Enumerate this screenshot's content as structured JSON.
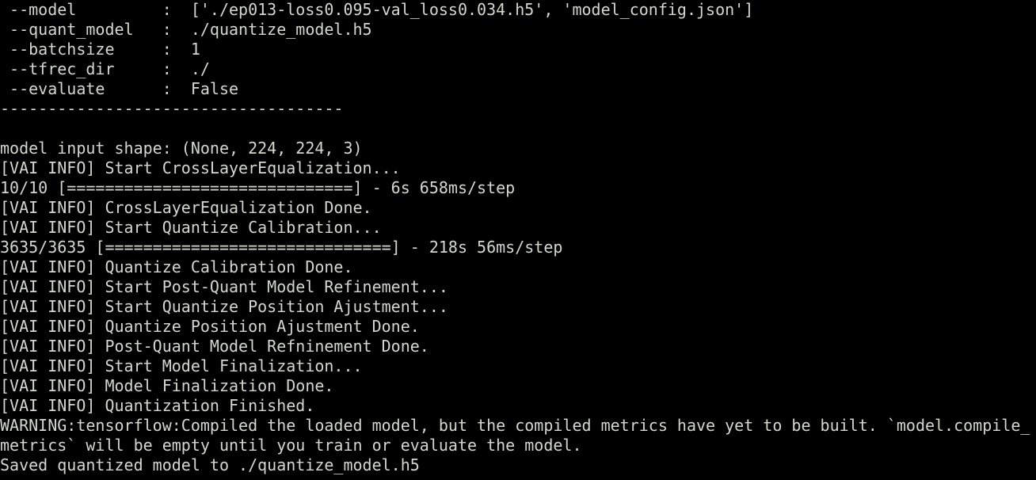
{
  "terminal": {
    "colors": {
      "background": "#000000",
      "foreground": "#d3d7cf",
      "highlight": "#cc0000"
    },
    "lines": [
      " --model         :  ['./ep013-loss0.095-val_loss0.034.h5', 'model_config.json']",
      " --quant_model   :  ./quantize_model.h5",
      " --batchsize     :  1",
      " --tfrec_dir     :  ./",
      " --evaluate      :  False",
      "------------------------------------",
      "",
      "model input shape: (None, 224, 224, 3)",
      "[VAI INFO] Start CrossLayerEqualization...",
      "10/10 [==============================] - 6s 658ms/step",
      "[VAI INFO] CrossLayerEqualization Done.",
      "[VAI INFO] Start Quantize Calibration...",
      "3635/3635 [==============================] - 218s 56ms/step",
      "[VAI INFO] Quantize Calibration Done.",
      "[VAI INFO] Start Post-Quant Model Refinement...",
      "[VAI INFO] Start Quantize Position Ajustment...",
      "[VAI INFO] Quantize Position Ajustment Done.",
      "[VAI INFO] Post-Quant Model Refninement Done.",
      "[VAI INFO] Start Model Finalization...",
      "[VAI INFO] Model Finalization Done.",
      "[VAI INFO] Quantization Finished.",
      "WARNING:tensorflow:Compiled the loaded model, but the compiled metrics have yet to be built. `model.compile_",
      "metrics` will be empty until you train or evaluate the model.",
      "Saved quantized model to ./quantize_model.h5"
    ]
  }
}
